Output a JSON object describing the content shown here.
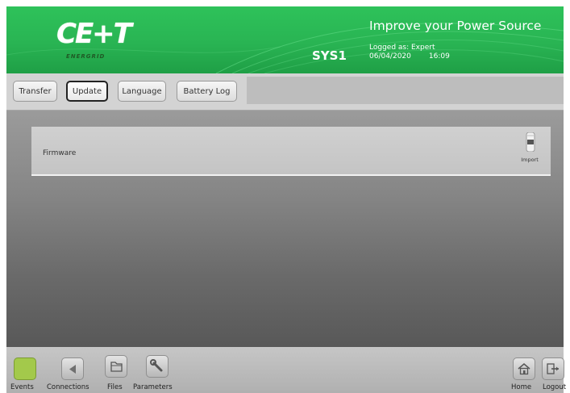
{
  "header": {
    "brand": "CE+T",
    "brand_sub": "ENERGRID",
    "system": "SYS1",
    "tagline": "Improve your Power Source",
    "logged_as": "Logged as: Expert",
    "date": "06/04/2020",
    "time": "16:09"
  },
  "toolbar": {
    "buttons": [
      {
        "label": "Transfer",
        "active": false
      },
      {
        "label": "Update",
        "active": true
      },
      {
        "label": "Language",
        "active": false
      },
      {
        "label": "Battery Log",
        "active": false
      }
    ]
  },
  "main": {
    "rows": [
      {
        "label": "Firmware",
        "action_label": "Import",
        "action_icon": "import-icon"
      }
    ]
  },
  "footer": {
    "left": [
      {
        "label": "Events",
        "icon": "events-icon"
      },
      {
        "label": "Connections",
        "icon": "connections-icon"
      },
      {
        "label": "Files",
        "icon": "files-icon"
      },
      {
        "label": "Parameters",
        "icon": "wrench-icon"
      }
    ],
    "right": [
      {
        "label": "Home",
        "icon": "home-icon"
      },
      {
        "label": "Logout",
        "icon": "logout-icon"
      }
    ]
  },
  "colors": {
    "header_green": "#2ec25a",
    "events_green": "#a3c94b",
    "toolbar_grey": "#d3d3d3"
  }
}
